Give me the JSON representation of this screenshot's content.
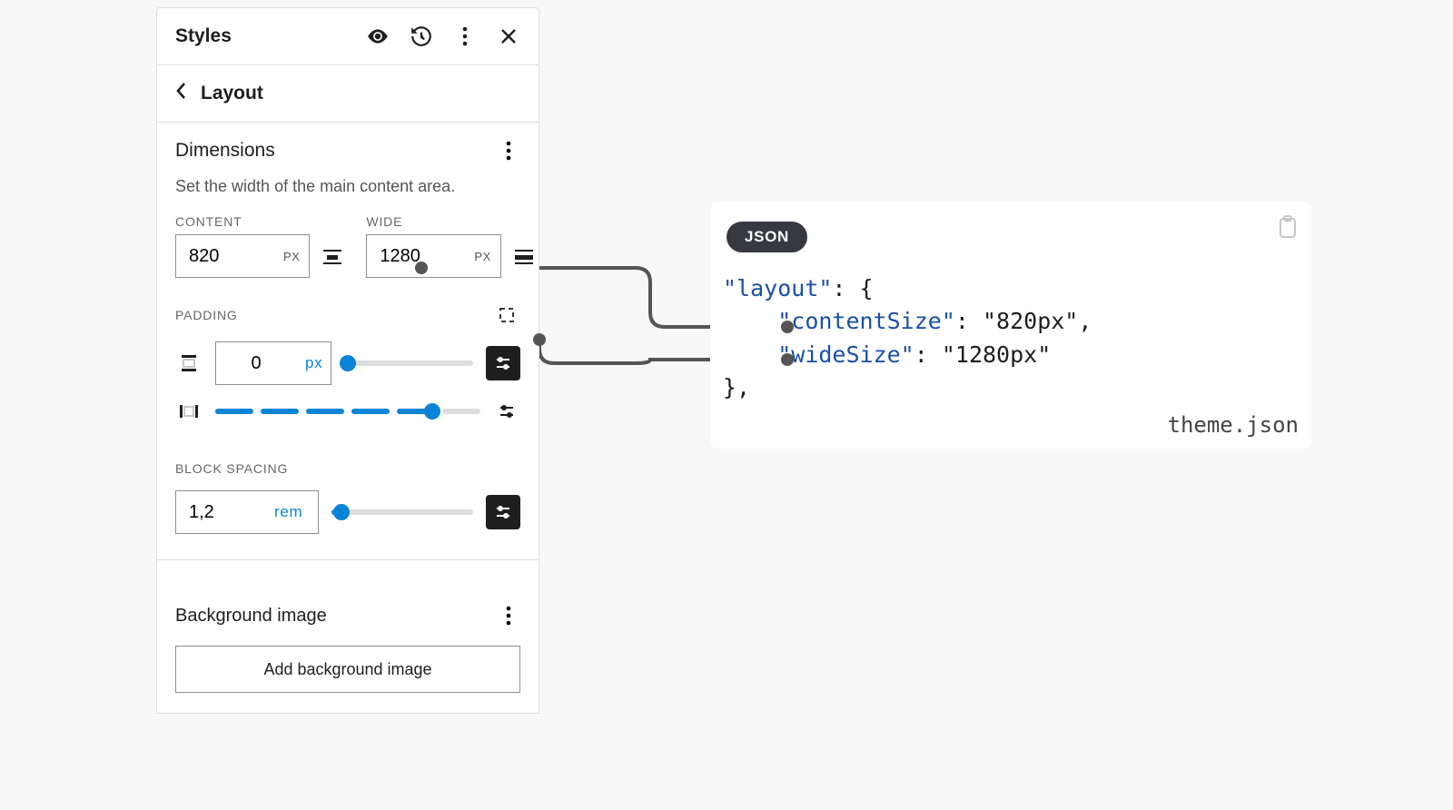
{
  "header": {
    "title": "Styles"
  },
  "nav": {
    "back_label": "Layout"
  },
  "dimensions": {
    "title": "Dimensions",
    "help": "Set the width of the main content area.",
    "content": {
      "label": "CONTENT",
      "value": "820",
      "unit": "PX"
    },
    "wide": {
      "label": "WIDE",
      "value": "1280",
      "unit": "PX"
    },
    "padding": {
      "label": "PADDING",
      "value": "0",
      "unit": "px",
      "slider_pct": 3,
      "seg_thumb_pct": 82
    },
    "block_spacing": {
      "label": "BLOCK SPACING",
      "value": "1,2",
      "unit": "rem",
      "slider_pct": 7
    },
    "bg": {
      "title": "Background image",
      "add": "Add background image"
    }
  },
  "code": {
    "badge": "JSON",
    "filename": "theme.json",
    "kv": {
      "layout": "\"layout\"",
      "contentSize_k": "\"contentSize\"",
      "contentSize_v": "\"820px\"",
      "wideSize_k": "\"wideSize\"",
      "wideSize_v": "\"1280px\""
    }
  }
}
